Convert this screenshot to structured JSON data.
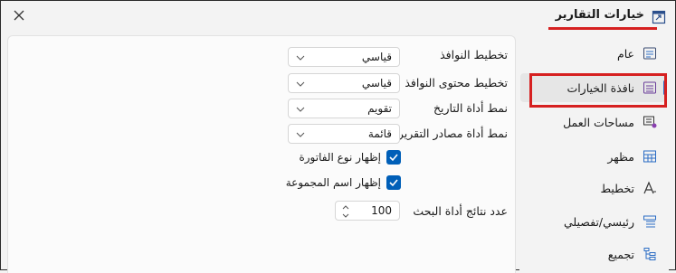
{
  "window": {
    "title": "خيارات التقارير"
  },
  "sidebar": {
    "items": [
      {
        "label": "عام",
        "icon": "general-settings-icon"
      },
      {
        "label": "نافذة الخيارات",
        "icon": "options-window-icon",
        "selected": true
      },
      {
        "label": "مساحات العمل",
        "icon": "workspaces-icon"
      },
      {
        "label": "مظهر",
        "icon": "appearance-icon"
      },
      {
        "label": "تخطيط",
        "icon": "layout-font-icon"
      },
      {
        "label": "رئيسي/تفصيلي",
        "icon": "master-detail-icon"
      },
      {
        "label": "تجميع",
        "icon": "grouping-icon"
      }
    ]
  },
  "options": {
    "window_layout": {
      "label": "تخطيط النوافذ",
      "value": "قياسي"
    },
    "window_content_layout": {
      "label": "تخطيط محتوى النوافذ",
      "value": "قياسي"
    },
    "date_tool_style": {
      "label": "نمط أداة التاريخ",
      "value": "تقويم"
    },
    "report_sources_style": {
      "label": "نمط أداة مصادر التقرير",
      "value": "قائمة"
    },
    "show_invoice_type": {
      "label": "إظهار نوع الفاتورة",
      "checked": true
    },
    "show_group_name": {
      "label": "إظهار اسم المجموعة",
      "checked": true
    },
    "search_results_count": {
      "label": "عدد نتائج أداة البحث",
      "value": "100"
    }
  },
  "colors": {
    "accent": "#005fb8",
    "highlight_red": "#d62020"
  }
}
